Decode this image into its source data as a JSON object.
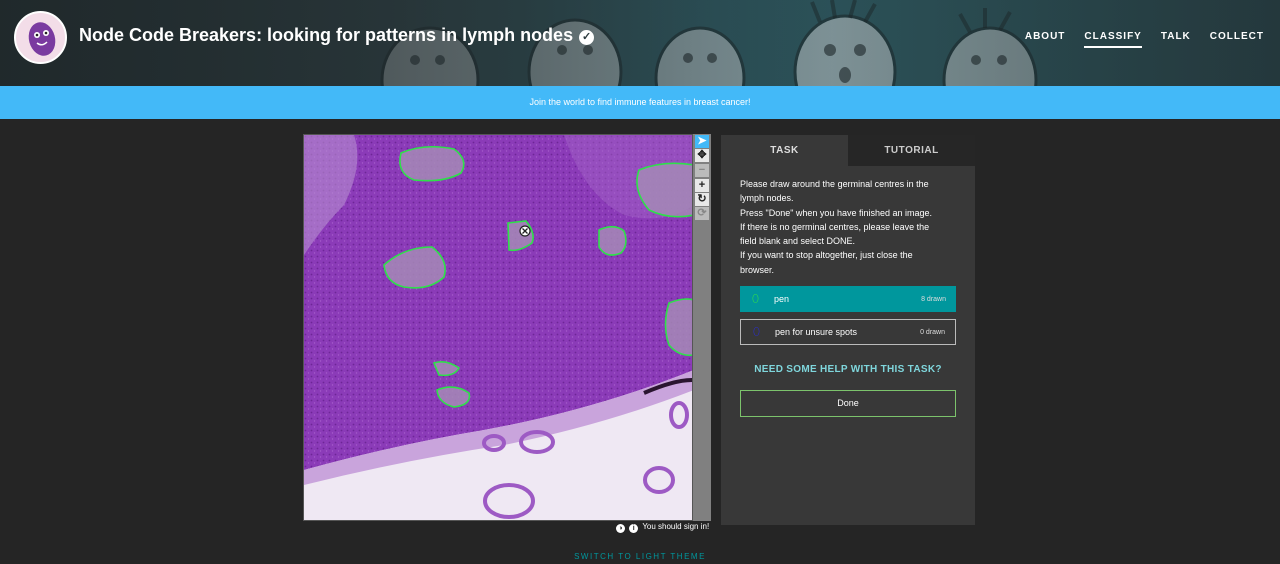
{
  "header": {
    "project_title": "Node Code Breakers: looking for patterns in lymph nodes",
    "verified_icon": "check-circle-icon",
    "nav": [
      {
        "label": "ABOUT",
        "active": false
      },
      {
        "label": "CLASSIFY",
        "active": true
      },
      {
        "label": "TALK",
        "active": false
      },
      {
        "label": "COLLECT",
        "active": false
      }
    ]
  },
  "banner": {
    "text": "Join the world to find immune features in breast cancer!"
  },
  "viewer": {
    "tools": [
      "pointer-icon",
      "move-icon",
      "zoom-out-icon",
      "zoom-in-icon",
      "rotate-icon",
      "reset-icon"
    ],
    "signin_text": "You should sign in!"
  },
  "panel": {
    "tabs": [
      "TASK",
      "TUTORIAL"
    ],
    "instructions": [
      "Please draw around the germinal centres in the",
      "lymph nodes.",
      "Press \"Done\" when you have finished an image.",
      "If there is no germinal centres, please leave the",
      "field blank and select DONE.",
      "If you want to stop altogether, just close the",
      "browser."
    ],
    "tools": [
      {
        "label": "pen",
        "count": "8 drawn",
        "color": "#2ee04a"
      },
      {
        "label": "pen for unsure spots",
        "count": "0 drawn",
        "color": "#2b2ed0"
      }
    ],
    "help": "NEED SOME HELP WITH THIS TASK?",
    "done": "Done"
  },
  "footer": {
    "theme_toggle": "SWITCH TO LIGHT THEME"
  },
  "colors": {
    "banner": "#43b9f8",
    "accent_teal": "#00979d",
    "pen_green": "#2ee04a",
    "unsure_blue": "#2b2ed0",
    "background": "#252525"
  }
}
